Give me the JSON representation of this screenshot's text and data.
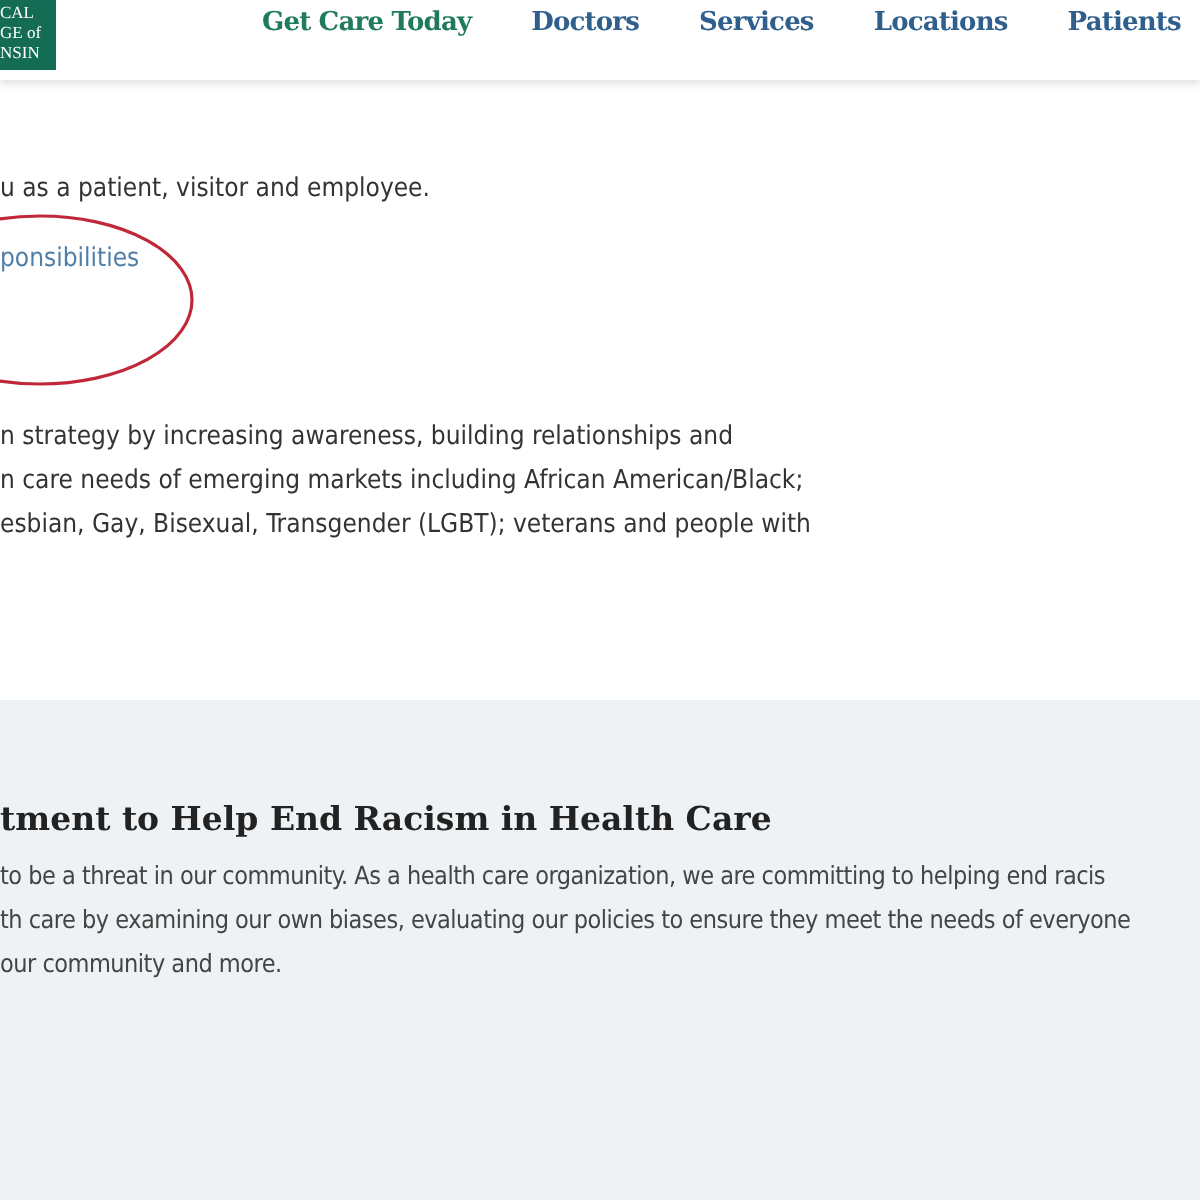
{
  "logo": {
    "lines": [
      "CAL",
      "GE of",
      "NSIN"
    ]
  },
  "nav": [
    {
      "label": "Get Care Today",
      "kind": "primary"
    },
    {
      "label": "Doctors",
      "kind": "link"
    },
    {
      "label": "Services",
      "kind": "link"
    },
    {
      "label": "Locations",
      "kind": "link"
    },
    {
      "label": "Patients",
      "kind": "link"
    }
  ],
  "intro": {
    "text": "u as a patient, visitor and employee.",
    "link": "ponsibilities"
  },
  "strategy": {
    "lines": [
      "n strategy by increasing awareness, building relationships and",
      "n care needs of emerging markets including African American/Black;",
      "esbian, Gay, Bisexual, Transgender (LGBT); veterans and people with"
    ]
  },
  "commitment": {
    "heading": "tment to Help End Racism in Health Care",
    "lines": [
      "to be a threat in our community. As a health care organization, we are committing to helping end racis",
      "th care by examining our own biases, evaluating our policies to ensure they meet the needs of everyone",
      "our community and more."
    ]
  }
}
